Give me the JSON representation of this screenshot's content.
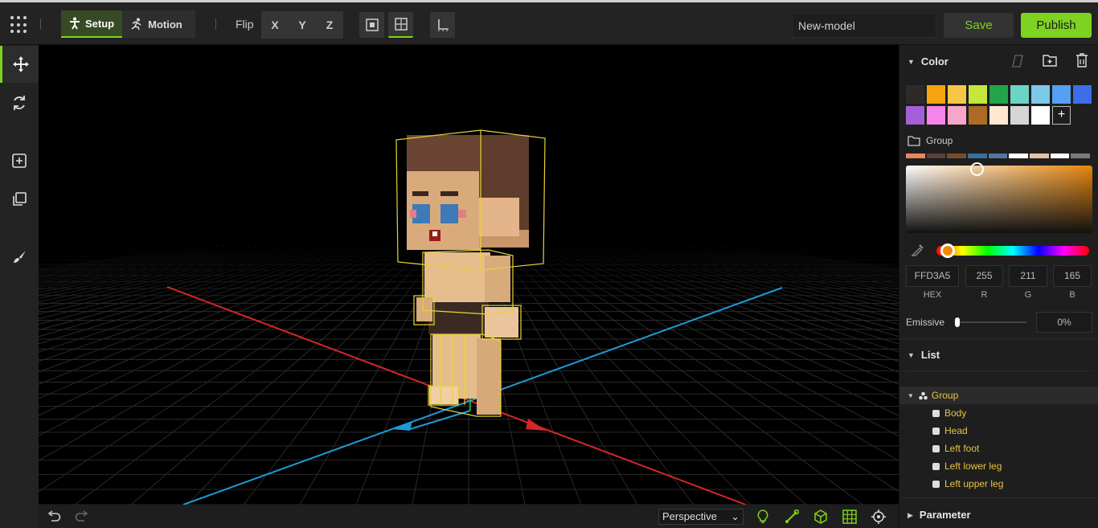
{
  "topbar": {
    "mode_setup": "Setup",
    "mode_motion": "Motion",
    "flip_label": "Flip",
    "axes": [
      "X",
      "Y",
      "Z"
    ],
    "model_name": "New-model",
    "save_label": "Save",
    "publish_label": "Publish"
  },
  "viewport": {
    "projection": "Perspective"
  },
  "panel": {
    "color_title": "Color",
    "swatches": [
      "#2e2a2a",
      "#f5a40f",
      "#f6c744",
      "#c5e63a",
      "#22a548",
      "#6ad5c6",
      "#7cc9ea",
      "#55a0f2",
      "#3c6ee8",
      "#a45fd8",
      "#f585e8",
      "#f6a6c8",
      "#ad6c22",
      "#ffe7d2",
      "#d6d6d6",
      "#ffffff"
    ],
    "add_swatch": "+",
    "group_label": "Group",
    "strip_colors": [
      "#e7875a",
      "#5a4036",
      "#7b4a2e",
      "#3c6c9c",
      "#52789c",
      "#ffffff",
      "#e9c2a0",
      "#ffffff",
      "#7a7a7a"
    ],
    "hex": "FFD3A5",
    "r": "255",
    "g": "211",
    "b": "165",
    "hex_label": "HEX",
    "r_label": "R",
    "g_label": "G",
    "b_label": "B",
    "emissive_label": "Emissive",
    "emissive_value": "0%",
    "list_title": "List",
    "tree_root": "Group",
    "tree_items": [
      "Body",
      "Head",
      "Left foot",
      "Left lower leg",
      "Left upper leg"
    ],
    "parameter_title": "Parameter"
  }
}
